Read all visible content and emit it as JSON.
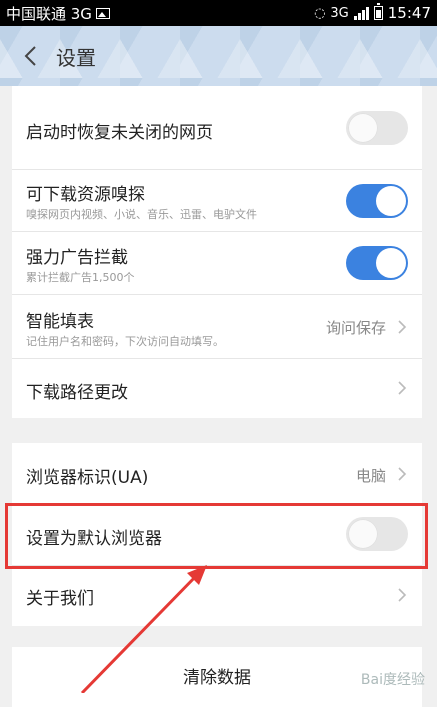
{
  "statusbar": {
    "carrier": "中国联通 3G",
    "network": "3G",
    "time": "15:47"
  },
  "header": {
    "title": "设置"
  },
  "settings": {
    "restore_tabs": {
      "title": "启动时恢复未关闭的网页",
      "enabled": false
    },
    "resource_sniff": {
      "title": "可下载资源嗅探",
      "subtitle": "嗅探网页内视频、小说、音乐、迅雷、电驴文件",
      "enabled": true
    },
    "ad_block": {
      "title": "强力广告拦截",
      "subtitle": "累计拦截广告1,500个",
      "enabled": true
    },
    "autofill": {
      "title": "智能填表",
      "subtitle": "记住用户名和密码，下次访问自动填写。",
      "value": "询问保存"
    },
    "download_path": {
      "title": "下载路径更改"
    },
    "user_agent": {
      "title": "浏览器标识(UA)",
      "value": "电脑"
    },
    "default_browser": {
      "title": "设置为默认浏览器",
      "enabled": false
    },
    "about": {
      "title": "关于我们"
    },
    "clear_data": {
      "label": "清除数据"
    }
  },
  "watermark": "Bai度经验",
  "colors": {
    "accent": "#3b82e0",
    "annotation": "#e53935",
    "header_bg": "#ccdcee"
  }
}
